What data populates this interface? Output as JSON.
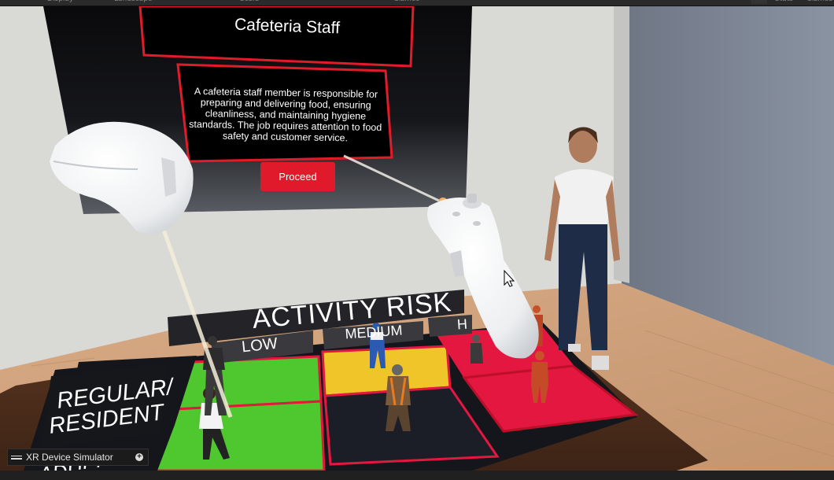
{
  "scene": {
    "panel_title": "Cafeteria Staff",
    "panel_description": "A cafeteria staff member is responsible for preparing and delivering food, ensuring cleanliness, and maintaining hygiene standards. The job requires attention to food safety and customer service.",
    "proceed_label": "Proceed",
    "board": {
      "header": "ACTIVITY RISK",
      "columns": [
        "LOW",
        "MEDIUM",
        "H"
      ],
      "row_label_lines": [
        "REGULAR/",
        "RESIDENT"
      ],
      "partial_bottom_label": "ADULT"
    }
  },
  "overlay": {
    "xr_simulator_label": "XR Device Simulator"
  },
  "colors": {
    "panel_border": "#e21b2a",
    "proceed_button": "#e01a2a",
    "low": "#4fc72f",
    "medium": "#f0c52a",
    "high": "#e3173f",
    "dark_tile": "#1c1e27"
  }
}
